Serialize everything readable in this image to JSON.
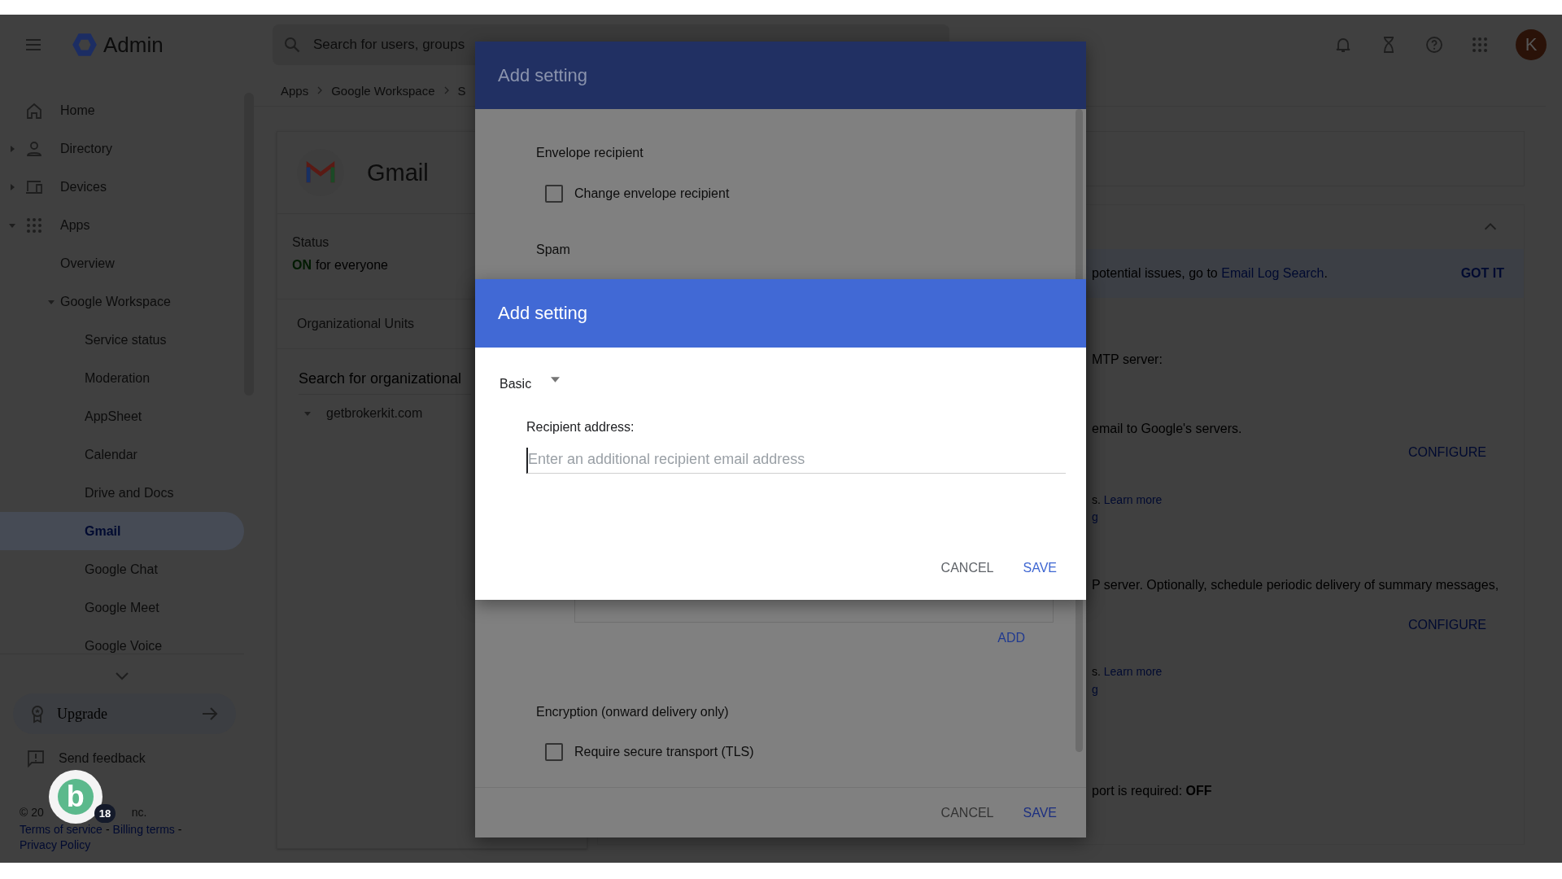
{
  "topbar": {
    "product": "Admin",
    "search": {
      "placeholder": "Search for users, groups"
    },
    "avatar": "K"
  },
  "sidebar": {
    "items": [
      {
        "label": "Home",
        "selected": false
      },
      {
        "label": "Directory",
        "selected": false,
        "expanded": false
      },
      {
        "label": "Devices",
        "selected": false,
        "expanded": false
      },
      {
        "label": "Apps",
        "selected": false,
        "expanded": true,
        "children": [
          {
            "label": "Overview",
            "selected": false
          },
          {
            "label": "Google Workspace",
            "selected": false,
            "expanded": true,
            "children": [
              {
                "label": "Service status",
                "selected": false
              },
              {
                "label": "Moderation",
                "selected": false
              },
              {
                "label": "AppSheet",
                "selected": false
              },
              {
                "label": "Calendar",
                "selected": false
              },
              {
                "label": "Drive and Docs",
                "selected": false
              },
              {
                "label": "Gmail",
                "selected": true
              },
              {
                "label": "Google Chat",
                "selected": false
              },
              {
                "label": "Google Meet",
                "selected": false
              },
              {
                "label": "Google Voice",
                "selected": false
              }
            ]
          }
        ]
      }
    ],
    "upgrade": "Upgrade",
    "feedback": "Send feedback",
    "footer": {
      "copyright_start": "© 20",
      "copyright_end": "nc.",
      "links": [
        {
          "kind": "link",
          "text": "Terms of service"
        },
        {
          "kind": "separator",
          "text": "-"
        },
        {
          "kind": "link",
          "text": "Billing terms"
        },
        {
          "kind": "separator",
          "text": "-"
        },
        {
          "kind": "link",
          "text": "Privacy Policy"
        }
      ]
    }
  },
  "widget": {
    "letter": "b",
    "badge": "18"
  },
  "breadcrumbs": [
    "Apps",
    "Google Workspace",
    "S"
  ],
  "app_card": {
    "title": "Gmail",
    "status": {
      "label": "Status",
      "state": "ON",
      "text": "for everyone"
    },
    "org_units": "Organizational Units",
    "org_search": {
      "placeholder": "Search for organizational"
    },
    "org": {
      "label": "getbrokerkit.com",
      "expanded": true
    }
  },
  "settings_panel": {
    "banner": {
      "text": "potential issues, go to ",
      "link": "Email Log Search",
      "after": ".",
      "action": "GOT IT"
    },
    "lines": [
      {
        "kind": "text",
        "text": "MTP server:"
      },
      {
        "kind": "text",
        "text": "email to Google's servers."
      },
      {
        "kind": "action",
        "text": "CONFIGURE"
      },
      {
        "kind": "text",
        "text": "s. ",
        "link": "Learn more"
      },
      {
        "kind": "link",
        "text": "g"
      },
      {
        "kind": "text",
        "text": "P server. Optionally, schedule periodic delivery of summary messages,"
      },
      {
        "kind": "action",
        "text": "CONFIGURE"
      },
      {
        "kind": "text",
        "text": "s. ",
        "link": "Learn more"
      },
      {
        "kind": "link",
        "text": "g"
      },
      {
        "kind": "text",
        "text": "port is required: **OFF**"
      }
    ]
  },
  "back_dialog": {
    "title": "Add setting",
    "envelope_heading": "Envelope recipient",
    "checkboxes": [
      {
        "label": "Change envelope recipient",
        "checked": false
      },
      {
        "label": "Require secure transport (TLS)",
        "checked": false
      }
    ],
    "spam_heading": "Spam",
    "add_action": "ADD",
    "encryption_heading": "Encryption (onward delivery only)",
    "buttons": [
      {
        "label": "CANCEL",
        "primary": false
      },
      {
        "label": "SAVE",
        "primary": true
      }
    ]
  },
  "front_dialog": {
    "title": "Add setting",
    "dropdown": {
      "value": "Basic"
    },
    "field": {
      "label": "Recipient address:",
      "placeholder": "Enter an additional recipient email address"
    },
    "buttons": [
      {
        "label": "CANCEL",
        "primary": false
      },
      {
        "label": "SAVE",
        "primary": true
      }
    ]
  }
}
